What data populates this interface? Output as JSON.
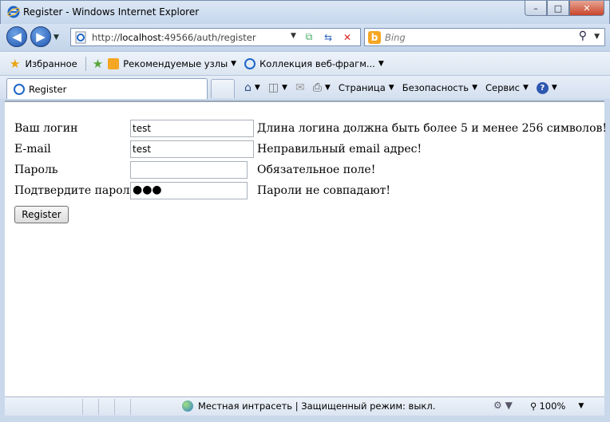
{
  "window": {
    "title": "Register - Windows Internet Explorer",
    "minimize": "–",
    "maximize": "□",
    "close": "✕"
  },
  "nav": {
    "address_prefix": "http://",
    "address_host": "localhost",
    "address_rest": ":49566/auth/register",
    "search_placeholder": "Bing",
    "back_icon": "back-arrow-icon",
    "forward_icon": "forward-arrow-icon"
  },
  "favorites": {
    "label": "Избранное",
    "items": [
      {
        "label": "Рекомендуемые узлы"
      },
      {
        "label": "Коллекция веб-фрагм..."
      }
    ]
  },
  "tab": {
    "label": "Register"
  },
  "commands": {
    "page": "Страница",
    "safety": "Безопасность",
    "tools": "Сервис"
  },
  "form": {
    "rows": [
      {
        "label": "Ваш логин",
        "value": "test",
        "error": "Длина логина должна быть более 5 и менее 256 символов!"
      },
      {
        "label": "E-mail",
        "value": "test",
        "error": "Неправильный email адрес!"
      },
      {
        "label": "Пароль",
        "value": "",
        "error": "Обязательное поле!"
      },
      {
        "label": "Подтвердите пароль",
        "value": "●●●",
        "error": "Пароли не совпадают!"
      }
    ],
    "submit_label": "Register"
  },
  "status": {
    "zone": "Местная интрасеть | Защищенный режим: выкл.",
    "zoom": "100%"
  },
  "colors": {
    "chrome": "#c9d8ea",
    "bing": "#f5a623",
    "close": "#c9452a"
  }
}
